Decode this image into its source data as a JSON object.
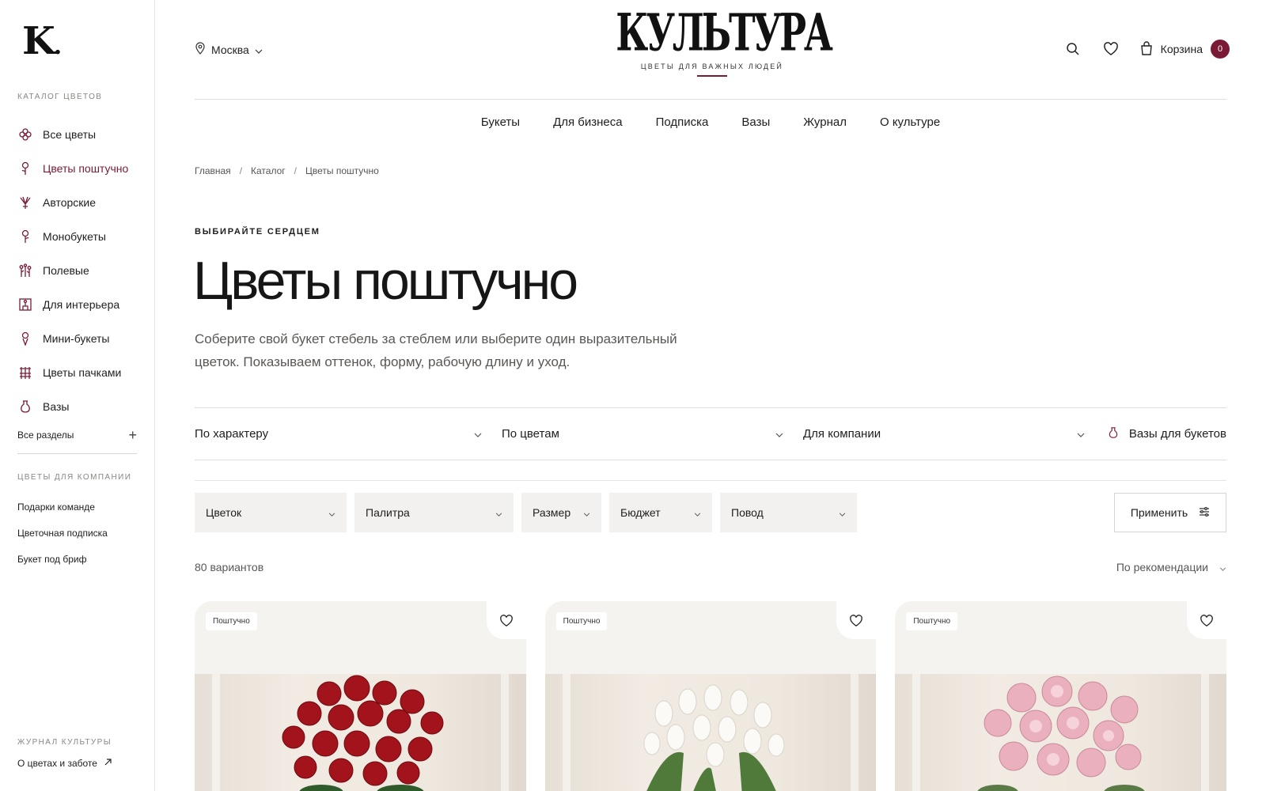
{
  "sidebar": {
    "catalog_title": "КАТАЛОГ ЦВЕТОВ",
    "items": [
      {
        "label": "Все цветы",
        "icon": "flower-icon"
      },
      {
        "label": "Цветы поштучно",
        "icon": "single-flower-icon",
        "active": true
      },
      {
        "label": "Авторские",
        "icon": "bouquet-icon"
      },
      {
        "label": "Монобукеты",
        "icon": "single-flower-icon"
      },
      {
        "label": "Полевые",
        "icon": "wildflowers-icon"
      },
      {
        "label": "Для интерьера",
        "icon": "interior-icon"
      },
      {
        "label": "Мини-букеты",
        "icon": "mini-bouquet-icon"
      },
      {
        "label": "Цветы пачками",
        "icon": "bundle-icon"
      },
      {
        "label": "Вазы",
        "icon": "vase-icon"
      }
    ],
    "all_sections": "Все разделы",
    "company_title": "ЦВЕТЫ ДЛЯ КОМПАНИИ",
    "company_items": [
      "Подарки команде",
      "Цветочная подписка",
      "Букет под бриф"
    ],
    "journal_title": "ЖУРНАЛ КУЛЬТУРЫ",
    "journal_link": "О цветах и заботе"
  },
  "header": {
    "city": "Москва",
    "brand": "КУЛЬТУРА",
    "brand_sub": "ЦВЕТЫ ДЛЯ ВАЖНЫХ ЛЮДЕЙ",
    "cart_label": "Корзина",
    "cart_count": "0"
  },
  "nav": [
    "Букеты",
    "Для бизнеса",
    "Подписка",
    "Вазы",
    "Журнал",
    "О культуре"
  ],
  "breadcrumb": [
    "Главная",
    "Каталог",
    "Цветы поштучно"
  ],
  "page": {
    "eyebrow": "ВЫБИРАЙТЕ СЕРДЦЕМ",
    "title": "Цветы поштучно",
    "description": "Соберите свой букет стебель за стеблем или выберите один выразительный цветок. Показываем оттенок, форму, рабочую длину и уход."
  },
  "filters": {
    "character": "По характеру",
    "colors": "По цветам",
    "company": "Для компании",
    "vases": "Вазы для букетов"
  },
  "selects": {
    "flower": "Цветок",
    "palette": "Палитра",
    "size": "Размер",
    "budget": "Бюджет",
    "occasion": "Повод",
    "apply": "Применить"
  },
  "results": {
    "count": "80 вариантов",
    "sort": "По рекомендации"
  },
  "cards": [
    {
      "badge": "Поштучно",
      "flower": "red-roses"
    },
    {
      "badge": "Поштучно",
      "flower": "white-tulips"
    },
    {
      "badge": "Поштучно",
      "flower": "pink-peonies"
    }
  ],
  "colors": {
    "accent": "#7a1a35",
    "text": "#1b1b1b",
    "muted": "#5a5754",
    "select_bg": "#f3f1ef"
  }
}
